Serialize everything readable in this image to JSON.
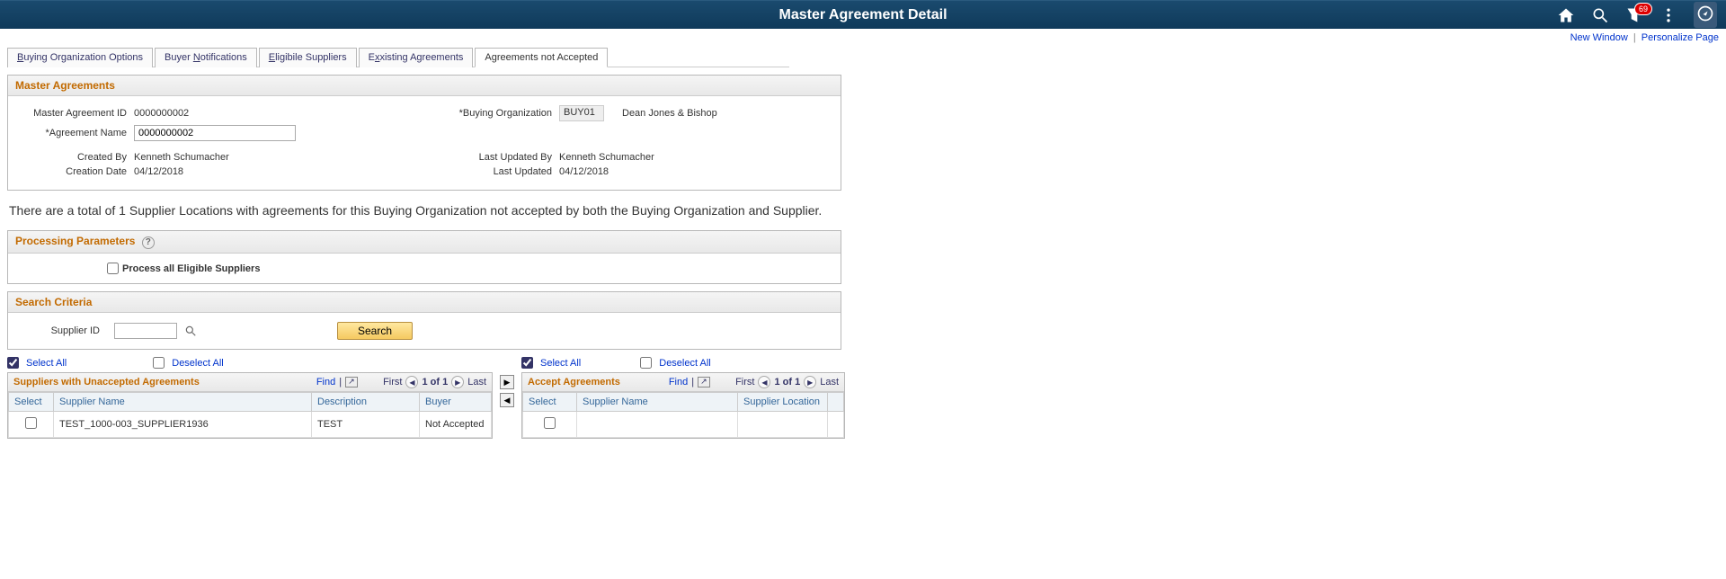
{
  "topbar": {
    "title": "Master Agreement Detail",
    "notification_count": "69"
  },
  "subheader": {
    "new_window": "New Window",
    "personalize": "Personalize Page"
  },
  "tabs": {
    "opt": "uying Organization Options",
    "notif": "otifications",
    "elig": "ligibile Suppliers",
    "exist": "xisting Agreements",
    "notacc": "Agreements not Accepted"
  },
  "master": {
    "header": "Master Agreements",
    "labels": {
      "id": "Master Agreement ID",
      "name": "*Agreement Name",
      "created_by": "Created By",
      "creation_date": "Creation Date",
      "buy_org": "*Buying Organization",
      "last_updated_by": "Last Updated By",
      "last_updated": "Last Updated"
    },
    "values": {
      "id": "0000000002",
      "name": "0000000002",
      "created_by": "Kenneth Schumacher",
      "creation_date": "04/12/2018",
      "buy_org": "BUY01",
      "buy_org_desc": "Dean Jones & Bishop",
      "last_updated_by": "Kenneth Schumacher",
      "last_updated": "04/12/2018"
    }
  },
  "info_text": "There are a total of 1 Supplier Locations with agreements for this Buying Organization not accepted by both the Buying Organization and Supplier.",
  "processing": {
    "header": "Processing Parameters",
    "checkbox_label": "Process all Eligible Suppliers"
  },
  "search": {
    "header": "Search Criteria",
    "supplier_id_label": "Supplier ID",
    "button": "Search"
  },
  "selectors": {
    "select_all": "Select All",
    "deselect_all": "Deselect All"
  },
  "grid_nav": {
    "find": "Find",
    "first": "First",
    "range": "1 of 1",
    "last": "Last"
  },
  "left_grid": {
    "title": "Suppliers with Unaccepted Agreements",
    "headers": {
      "select": "Select",
      "name": "Supplier Name",
      "desc": "Description",
      "buyer": "Buyer"
    },
    "rows": [
      {
        "name": "TEST_1000-003_SUPPLIER1936",
        "desc": "TEST",
        "buyer": "Not Accepted"
      }
    ]
  },
  "right_grid": {
    "title": "Accept Agreements",
    "headers": {
      "select": "Select",
      "name": "Supplier Name",
      "loc": "Supplier Location"
    }
  }
}
